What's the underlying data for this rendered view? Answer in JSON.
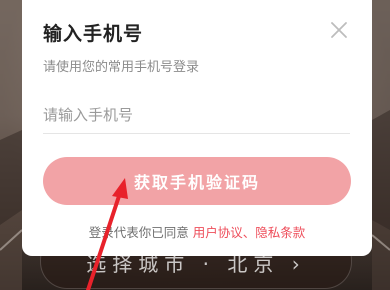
{
  "dialog": {
    "title": "输入手机号",
    "subtitle": "请使用您的常用手机号登录",
    "phone_placeholder": "请输入手机号",
    "phone_value": "",
    "code_button_label": "获取手机验证码",
    "agreement_prefix": "登录代表你已同意",
    "user_agreement_label": "用户协议",
    "separator": "、",
    "privacy_label": "隐私条款",
    "close_icon": "close-icon"
  },
  "background": {
    "select_city_text": "选择城市 · 北京 ›"
  },
  "colors": {
    "accent": "#ee4d5a",
    "button_disabled": "#f2a3a6",
    "annotation_arrow": "#e8222b"
  }
}
